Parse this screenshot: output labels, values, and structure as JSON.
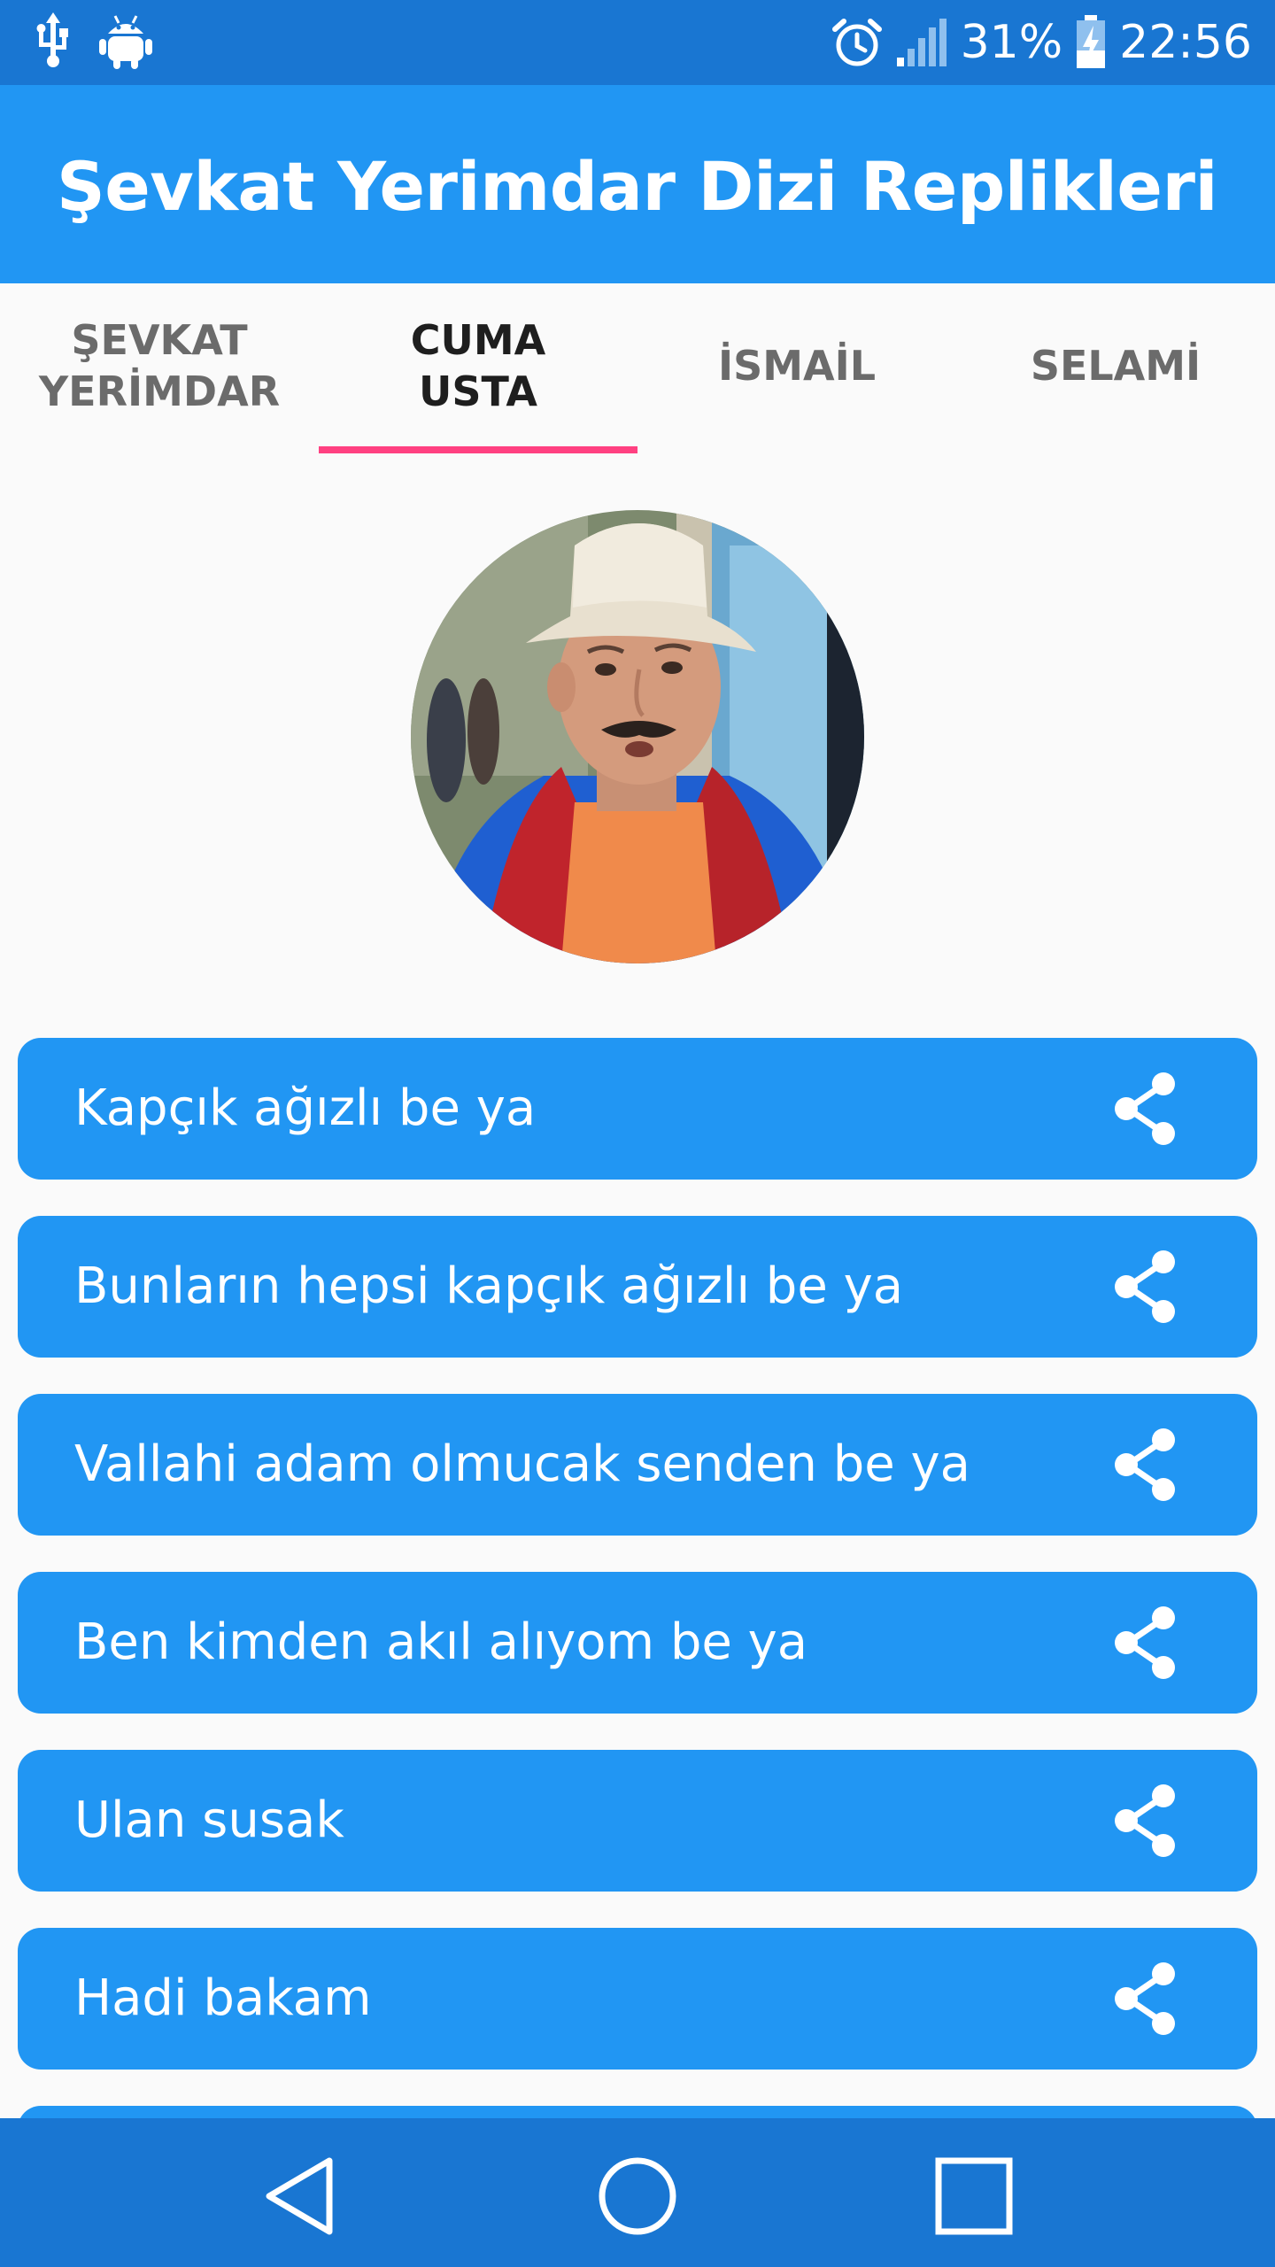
{
  "status_bar": {
    "battery": "31%",
    "time": "22:56",
    "icons": [
      "usb-icon",
      "android-debug-icon",
      "alarm-icon",
      "signal-icon",
      "battery-charging-icon"
    ]
  },
  "app_bar": {
    "title": "Şevkat Yerimdar Dizi Replikleri"
  },
  "tabs": [
    {
      "label": "ŞEVKAT YERİMDAR",
      "line1": "ŞEVKAT",
      "line2": "YERİMDAR",
      "active": false
    },
    {
      "label": "CUMA USTA",
      "line1": "CUMA",
      "line2": "USTA",
      "active": true
    },
    {
      "label": "İSMAİL",
      "line1": "İSMAİL",
      "line2": "",
      "active": false
    },
    {
      "label": "SELAMİ",
      "line1": "SELAMİ",
      "line2": "",
      "active": false
    }
  ],
  "quotes": [
    {
      "text": "Kapçık ağızlı be ya"
    },
    {
      "text": "Bunların hepsi kapçık ağızlı be ya"
    },
    {
      "text": "Vallahi adam olmucak senden be ya"
    },
    {
      "text": "Ben kimden akıl alıyom be ya"
    },
    {
      "text": "Ulan susak"
    },
    {
      "text": "Hadi bakam"
    }
  ],
  "colors": {
    "primary": "#2196F3",
    "primary_dark": "#1976D2",
    "accent": "#FF4081",
    "background": "#FAFAFA"
  },
  "nav": {
    "icons": [
      "back-icon",
      "home-icon",
      "recents-icon"
    ]
  }
}
